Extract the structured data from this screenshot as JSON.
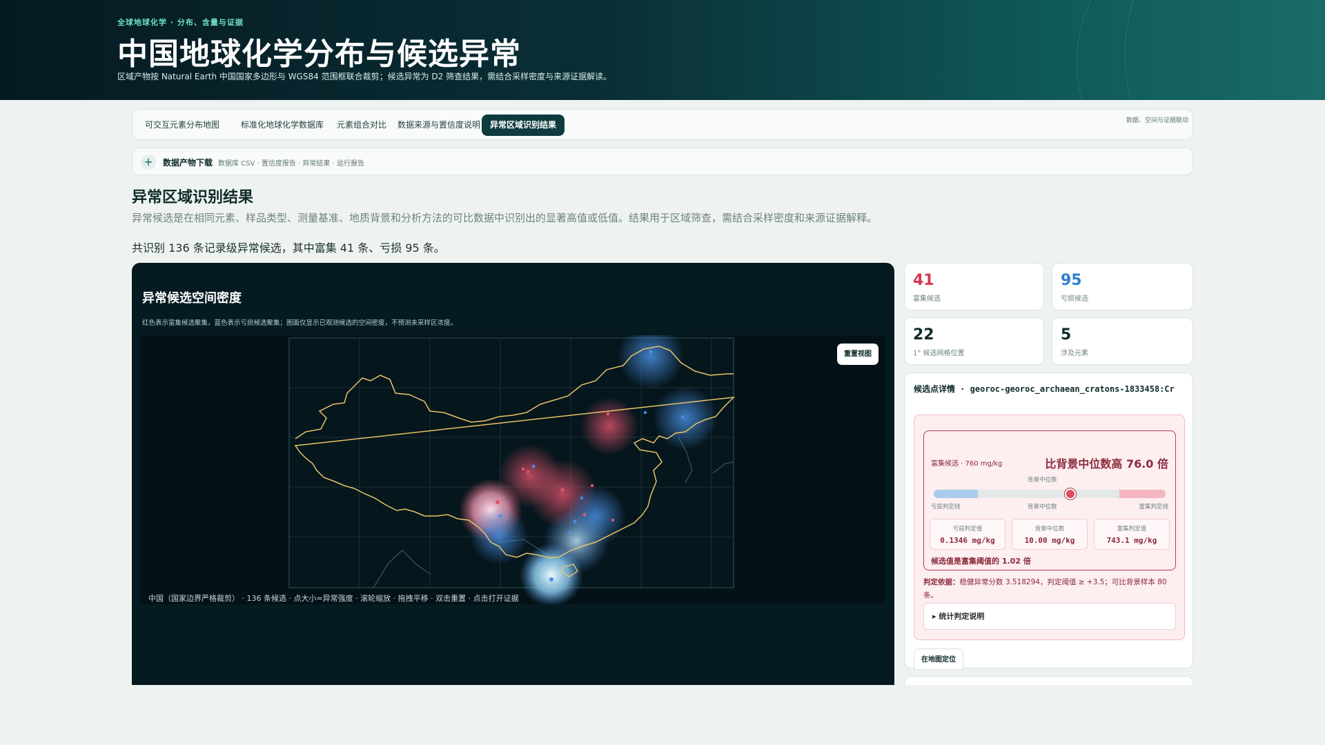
{
  "hero": {
    "eyebrow": "全球地球化学 · 分布、含量与证据",
    "title": "中国地球化学分布与候选异常",
    "subtitle": "区域产物按 Natural Earth 中国国家多边形与 WGS84 范围框联合裁剪；候选异常为 D2 筛查结果，需结合采样密度与来源证据解读。"
  },
  "tabs": {
    "items": [
      {
        "label": "可交互元素分布地图"
      },
      {
        "label": "标准化地球化学数据库"
      },
      {
        "label": "元素组合对比"
      },
      {
        "label": "数据来源与置信度说明"
      },
      {
        "label": "异常区域识别结果"
      }
    ],
    "active_index": 4,
    "hint": "数据、空间与证据联动"
  },
  "downloads": {
    "title": "数据产物下载",
    "desc": "数据库 CSV · 置信度报告 · 异常结果 · 运行报告"
  },
  "section": {
    "title": "异常区域识别结果",
    "desc": "异常候选是在相同元素、样品类型、测量基准、地质背景和分析方法的可比数据中识别出的显著高值或低值。结果用于区域筛查，需结合采样密度和来源证据解释。",
    "summary": "共识别 136 条记录级异常候选，其中富集 41 条、亏损 95 条。"
  },
  "map": {
    "title": "异常候选空间密度",
    "note": "红色表示富集候选聚集，蓝色表示亏损候选聚集；图面仅显示已观测候选的空间密度，不预测未采样区浓度。",
    "reset_label": "重置视图",
    "caption": "中国（国家边界严格裁剪） · 136 条候选 · 点大小=异常强度 · 滚轮缩放 · 拖拽平移 · 双击重置 · 点击打开证据"
  },
  "stats": [
    {
      "value": "41",
      "label": "富集候选",
      "color": "#d9364f"
    },
    {
      "value": "95",
      "label": "亏损候选",
      "color": "#2f7fd1"
    },
    {
      "value": "22",
      "label": "1° 候选网格位置",
      "color": "#0f2a2a"
    },
    {
      "value": "5",
      "label": "涉及元素",
      "color": "#0f2a2a"
    }
  ],
  "detail": {
    "title": "候选点详情 · georoc-georoc_archaean_cratons-1833458:Cr",
    "tag": "富集候选 · 760 mg/kg",
    "headline": "比背景中位数高 76.0 倍",
    "median_top": "背景中位数",
    "scale_left": "亏损判定线",
    "scale_mid": "背景中位数",
    "scale_right": "富集判定线",
    "gauge": {
      "low_fraction": 0.19,
      "high_fraction": 0.2,
      "marker_fraction": 0.59
    },
    "values": [
      {
        "label": "亏损判定值",
        "value": "0.1346 mg/kg"
      },
      {
        "label": "背景中位数",
        "value": "10.00 mg/kg"
      },
      {
        "label": "富集判定值",
        "value": "743.1 mg/kg"
      }
    ],
    "ratio": "候选值是富集阈值的 1.02 倍",
    "basis_label": "判定依据：",
    "basis_text": "稳健异常分数 3.518294，判定阈值 ≥ +3.5；可比背景样本 80 条。",
    "expander": "▸ 统计判定说明",
    "locate_label": "在地图定位"
  }
}
